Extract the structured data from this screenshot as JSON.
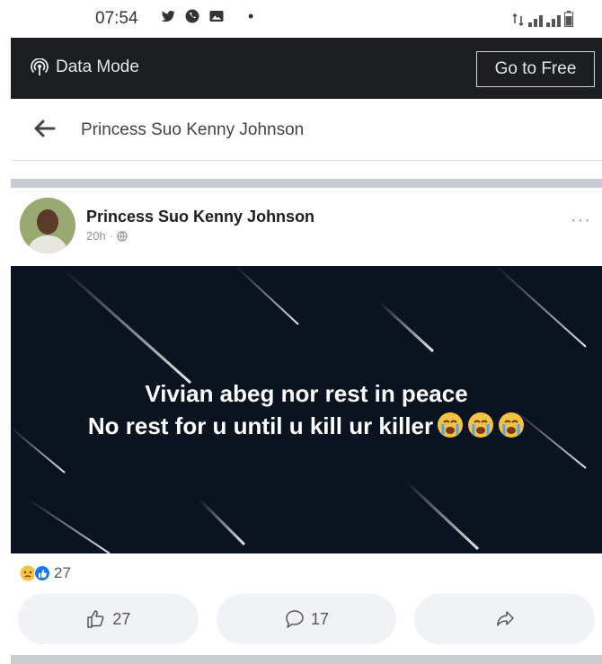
{
  "status_bar": {
    "time": "07:54",
    "left_icons": [
      "twitter-icon",
      "whatsapp-icon",
      "gallery-icon"
    ],
    "dot": "•"
  },
  "data_mode": {
    "label": "Data Mode",
    "go_free_label": "Go to Free"
  },
  "nav": {
    "title": "Princess Suo Kenny Johnson"
  },
  "post": {
    "author": "Princess Suo Kenny Johnson",
    "time": "20h",
    "meta_separator": "·",
    "more": "···",
    "image_text_line1": "Vivian abeg nor rest in peace",
    "image_text_line2": "No rest for u until u kill ur killer",
    "reaction_count": "27",
    "like_count": "27",
    "comment_count": "17"
  },
  "colors": {
    "dark_bar": "#1c1e21",
    "image_bg": "#0c1320",
    "pill_bg": "#f0f2f5",
    "separator": "#c9ccd1"
  }
}
